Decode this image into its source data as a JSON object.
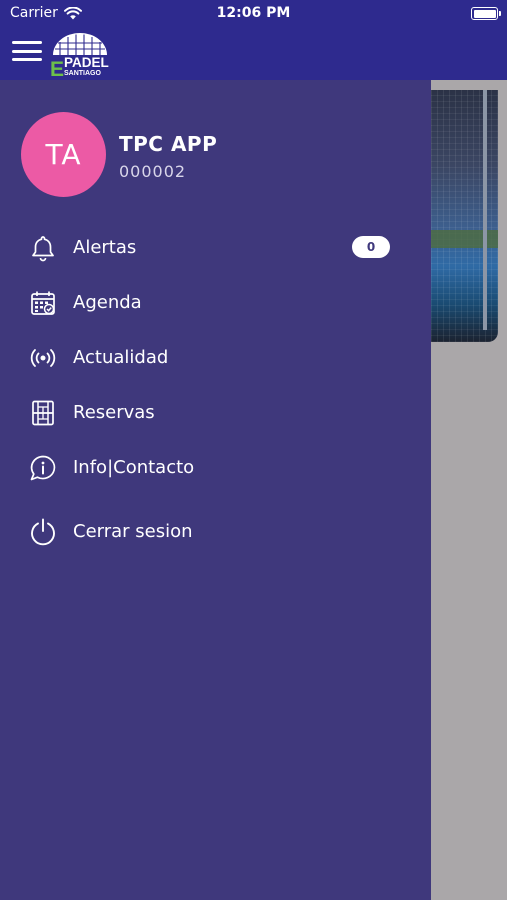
{
  "status_bar": {
    "carrier": "Carrier",
    "time": "12:06 PM"
  },
  "header": {
    "logo_main": "PADEL",
    "logo_sub": "SANTIAGO",
    "logo_letter": "E"
  },
  "profile": {
    "initials": "TA",
    "name": "TPC APP",
    "id": "000002"
  },
  "menu": {
    "items": [
      {
        "label": "Alertas",
        "icon": "bell-icon",
        "badge": "0"
      },
      {
        "label": "Agenda",
        "icon": "calendar-icon"
      },
      {
        "label": "Actualidad",
        "icon": "broadcast-icon"
      },
      {
        "label": "Reservas",
        "icon": "court-icon"
      },
      {
        "label": "Info|Contacto",
        "icon": "info-chat-icon"
      },
      {
        "label": "Cerrar sesion",
        "icon": "power-icon"
      }
    ]
  },
  "colors": {
    "header": "#2e2a8e",
    "drawer": "#3f387c",
    "avatar": "#ec5aa5",
    "logo_green": "#6cc04a"
  }
}
